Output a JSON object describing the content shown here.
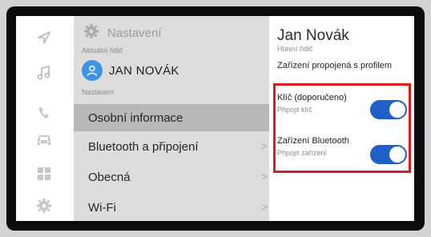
{
  "rail": {
    "icons": [
      "navigation-icon",
      "music-icon",
      "phone-icon",
      "car-icon",
      "apps-icon",
      "settings-icon"
    ]
  },
  "list": {
    "title": "Nastavení",
    "driver_label": "Aktuální řidič",
    "driver_name": "JAN NOVÁK",
    "section_label": "Nastavení",
    "items": [
      {
        "label": "Osobní informace",
        "selected": true,
        "has_chevron": false
      },
      {
        "label": "Bluetooth a připojení",
        "selected": false,
        "has_chevron": true,
        "chevron": ">"
      },
      {
        "label": "Obecná",
        "selected": false,
        "has_chevron": true,
        "chevron": ">"
      },
      {
        "label": "Wi-Fi",
        "selected": false,
        "has_chevron": true,
        "chevron": ">"
      }
    ]
  },
  "detail": {
    "profile_name": "Jan Novák",
    "profile_role": "Hlavní řidič",
    "linked_devices_title": "Zařízení propojená s profilem",
    "devices": [
      {
        "title": "Klíč (doporučeno)",
        "subtitle": "Připojit klíč",
        "enabled": true
      },
      {
        "title": "Zařízení Bluetooth",
        "subtitle": "Připojit zařízení",
        "enabled": true
      }
    ]
  },
  "colors": {
    "accent": "#1f5fc8",
    "highlight_border": "#e0191f",
    "avatar": "#3f93e6"
  }
}
